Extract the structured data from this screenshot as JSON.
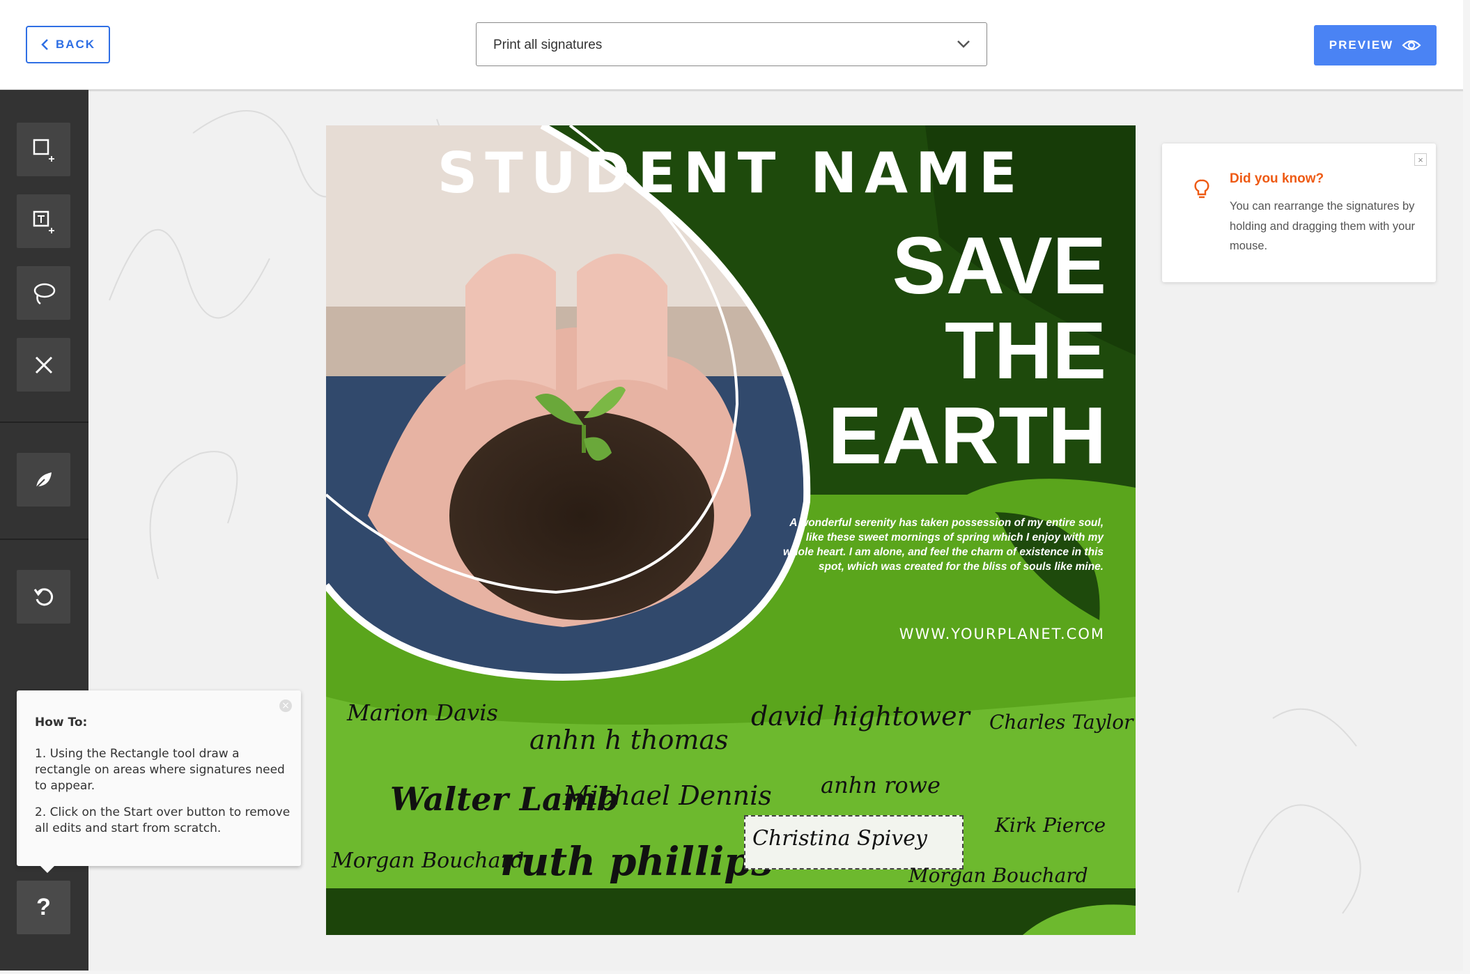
{
  "header": {
    "back_label": "BACK",
    "print_select_value": "Print all signatures",
    "preview_label": "PREVIEW"
  },
  "sidebar": {
    "tools": [
      "add-rectangle-tool",
      "add-text-tool",
      "lasso-tool",
      "delete-tool",
      "signature-feather-tool",
      "undo-tool"
    ],
    "help_label": "?"
  },
  "howto": {
    "title": "How To:",
    "step1": "1. Using the Rectangle tool draw a rectangle on areas where signatures need to appear.",
    "step2": "2. Click on the Start over button to remove all edits and start from scratch."
  },
  "tip": {
    "title": "Did you know?",
    "body": "You can rearrange the signatures by holding and dragging them with your mouse."
  },
  "poster": {
    "student_name": "STUDENT NAME",
    "headline_1": "SAVE",
    "headline_2": "THE",
    "headline_3": "EARTH",
    "body": "A wonderful serenity has taken possession of my entire soul, like these sweet mornings of spring which I enjoy with my whole heart. I am alone, and feel the charm of existence in this spot, which was created for the bliss of souls like mine.",
    "url": "WWW.YOURPLANET.COM",
    "colors": {
      "dark_green": "#1e4a0c",
      "mid_green": "#4f9d1a",
      "light_green": "#6db92e"
    }
  },
  "signatures": [
    "Marion Davis",
    "anhn h thomas",
    "david hightower",
    "Charles Taylor",
    "Walter Lamb",
    "Michael Dennis",
    "anhn rowe",
    "Kirk Pierce",
    "Morgan Bouchard",
    "ruth phillips",
    "Christina Spivey",
    "Morgan Bouchard"
  ],
  "selected_signature": "Christina Spivey"
}
